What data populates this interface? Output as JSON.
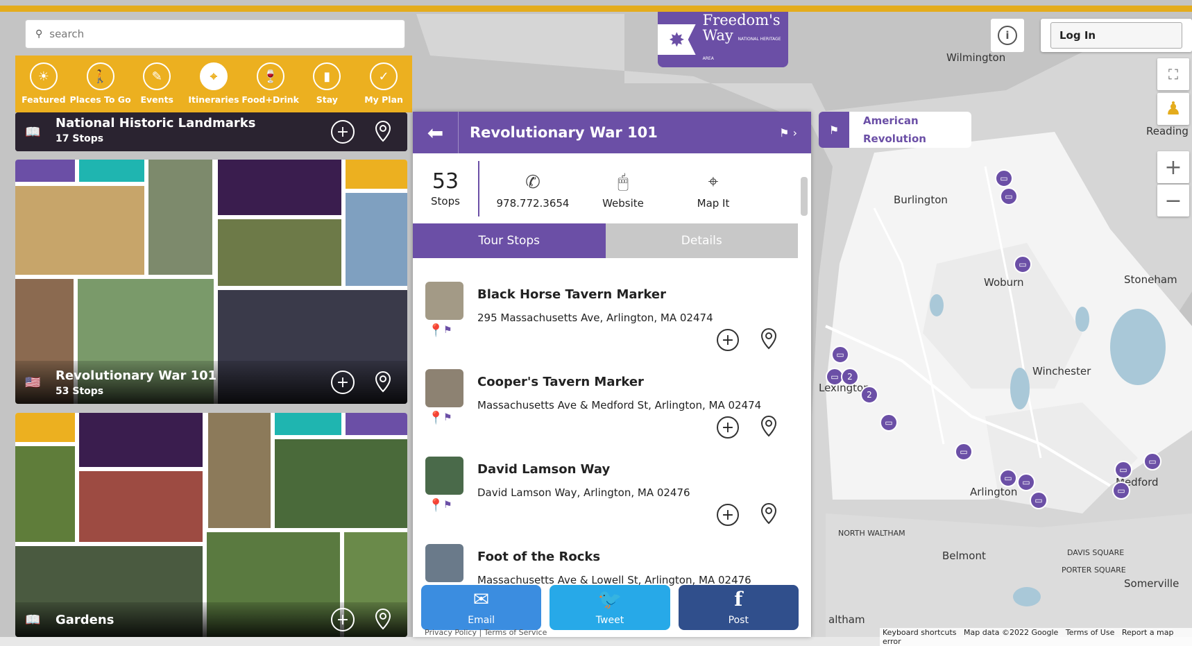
{
  "search": {
    "placeholder": "search"
  },
  "categories": [
    {
      "label": "Featured",
      "icon": "sun-icon"
    },
    {
      "label": "Places To Go",
      "icon": "walker-icon"
    },
    {
      "label": "Events",
      "icon": "ticket-icon"
    },
    {
      "label": "Itineraries",
      "icon": "route-icon"
    },
    {
      "label": "Food+Drink",
      "icon": "glass-icon"
    },
    {
      "label": "Stay",
      "icon": "luggage-icon"
    },
    {
      "label": "My Plan",
      "icon": "check-icon"
    }
  ],
  "cards": [
    {
      "title": "National Historic Landmarks",
      "stops": "17 Stops"
    },
    {
      "title": "Revolutionary War 101",
      "stops": "53 Stops"
    },
    {
      "title": "Gardens",
      "stops": ""
    }
  ],
  "logo": {
    "line1": "Freedom's",
    "line2": "Way",
    "small": "NATIONAL HERITAGE AREA"
  },
  "header": {
    "login": "Log In"
  },
  "tag": {
    "label": "American Revolution"
  },
  "panel": {
    "title": "Revolutionary War 101",
    "count": "53",
    "count_label": "Stops",
    "phone": "978.772.3654",
    "website": "Website",
    "mapit": "Map It",
    "tab_stops": "Tour Stops",
    "tab_details": "Details"
  },
  "stops": [
    {
      "name": "Black Horse Tavern Marker",
      "address": "295 Massachusetts Ave, Arlington, MA 02474"
    },
    {
      "name": "Cooper's Tavern Marker",
      "address": "Massachusetts Ave & Medford St, Arlington, MA 02474"
    },
    {
      "name": "David Lamson Way",
      "address": "David Lamson Way, Arlington, MA 02476"
    },
    {
      "name": "Foot of the Rocks",
      "address": "Massachusetts Ave & Lowell St, Arlington, MA 02476"
    }
  ],
  "share": {
    "email": "Email",
    "tweet": "Tweet",
    "post": "Post"
  },
  "legal": {
    "privacy": "Privacy Policy",
    "sep": "|",
    "terms": "Terms of Service"
  },
  "map_labels": [
    "Wilmington",
    "Reading",
    "Burlington",
    "Woburn",
    "Stoneham",
    "Winchester",
    "Lexington",
    "Arlington",
    "Medford",
    "NORTH WALTHAM",
    "Belmont",
    "DAVIS SQUARE",
    "PORTER SQUARE",
    "Somerville",
    "altham"
  ],
  "map_attribution": {
    "shortcuts": "Keyboard shortcuts",
    "data": "Map data ©2022 Google",
    "terms": "Terms of Use",
    "report": "Report a map error"
  },
  "marker_counts": [
    "2",
    "2"
  ],
  "colors": {
    "purple": "#6b4fa6",
    "gold": "#ecb020",
    "email": "#3b8de0",
    "twitter": "#27a9e8",
    "facebook": "#304f8c"
  }
}
